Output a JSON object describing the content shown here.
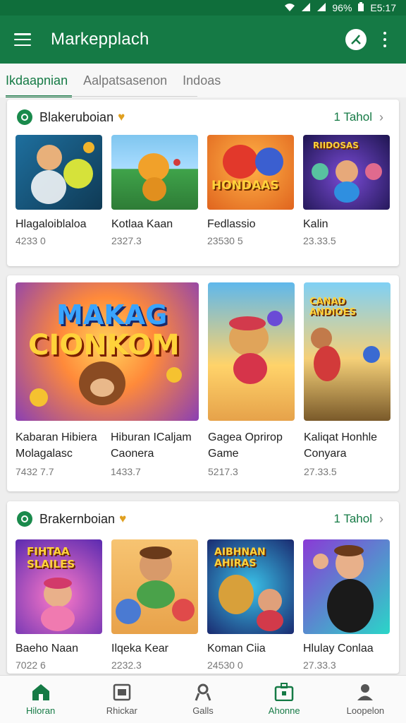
{
  "status": {
    "battery": "96%",
    "time": "E5:17"
  },
  "appbar": {
    "title": "Markepplach"
  },
  "tabs": [
    {
      "label": "Ikdaapnian",
      "active": true
    },
    {
      "label": "Aalpatsasenon",
      "active": false
    },
    {
      "label": "Indoas",
      "active": false
    }
  ],
  "section1": {
    "title": "Blakeruboian",
    "see_all": "1 Tahol",
    "items": [
      {
        "name": "Hlagaloiblaloa",
        "sub": "4233 0"
      },
      {
        "name": "Kotlaa Kaan",
        "sub": "2327.3"
      },
      {
        "name": "Fedlassio",
        "sub": "23530 5"
      },
      {
        "name": "Kalin",
        "sub": "23.33.5"
      }
    ],
    "thumb_texts": [
      "HONDAAS",
      "RIIDOSAS"
    ]
  },
  "section2": {
    "items": [
      {
        "name_line1": "Kabaran Hibiera",
        "name_line2": "Molagalasc",
        "sub": "7432 7.7"
      },
      {
        "name_line1": "Hiburan ICaljam",
        "name_line2": "Caonera",
        "sub": "1433.7"
      },
      {
        "name_line1": "Gagea Oprirop",
        "name_line2": "Game",
        "sub": "5217.3"
      },
      {
        "name_line1": "Kaliqat Honhle",
        "name_line2": "Conyara",
        "sub": "27.33.5"
      }
    ],
    "banner_text_top": "MAKAG",
    "banner_text_bottom": "CIONKOM",
    "thumb4_text": "CANAD ANDIOES"
  },
  "section3": {
    "title": "Brakernboian",
    "see_all": "1 Tahol",
    "items": [
      {
        "name": "Baeho Naan",
        "sub": "7022 6"
      },
      {
        "name": "Ilqeka Kear",
        "sub": "2232.3"
      },
      {
        "name": "Koman Ciia",
        "sub": "24530 0"
      },
      {
        "name": "Hlulay Conlaa",
        "sub": "27.33.3"
      }
    ],
    "thumb1_text": "FIHTAA SLAILES",
    "thumb3_text": "AIBHNAN AHIRAS"
  },
  "bottom_nav": [
    {
      "label": "Hiloran",
      "icon": "home-icon",
      "active": true
    },
    {
      "label": "Rhickar",
      "icon": "store-icon",
      "active": false
    },
    {
      "label": "Galls",
      "icon": "person-icon",
      "active": false
    },
    {
      "label": "Ahonne",
      "icon": "briefcase-icon",
      "active": true
    },
    {
      "label": "Loopelon",
      "icon": "account-icon",
      "active": false
    }
  ],
  "colors": {
    "primary": "#157a45",
    "statusbar": "#0f6e3b",
    "accent_gold": "#e0a020"
  }
}
